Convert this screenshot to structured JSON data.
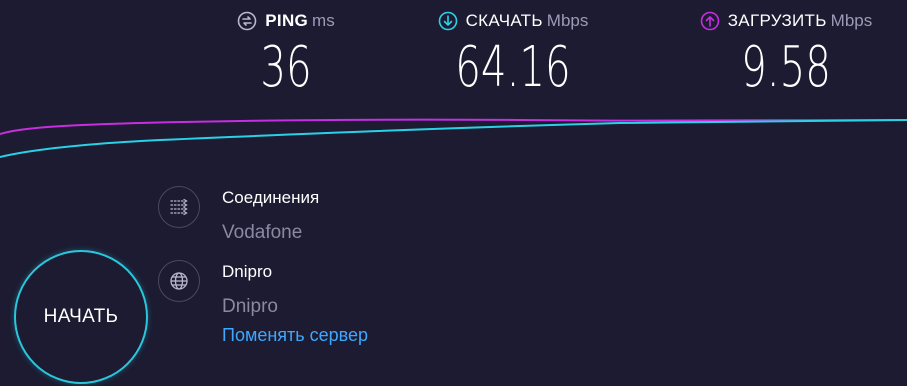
{
  "metrics": {
    "ping": {
      "label": "PING",
      "unit": "ms",
      "value": "36",
      "icon": "ping-icon",
      "color": "#b9b7cc"
    },
    "download": {
      "label": "СКАЧАТЬ",
      "unit": "Mbps",
      "value": "64.16",
      "icon": "download-icon",
      "color": "#2ad1e6"
    },
    "upload": {
      "label": "ЗАГРУЗИТЬ",
      "unit": "Mbps",
      "value": "9.58",
      "icon": "upload-icon",
      "color": "#c62ee0"
    }
  },
  "graph": {
    "download_color": "#2ad1e6",
    "upload_color": "#c62ee0"
  },
  "connection": {
    "title": "Соединения",
    "provider": "Vodafone",
    "icon": "connections-icon"
  },
  "server": {
    "title": "Dnipro",
    "location": "Dnipro",
    "change_label": "Поменять сервер",
    "icon": "globe-icon"
  },
  "start": {
    "label": "НАЧАТЬ",
    "color": "#2ac7dc"
  },
  "colors": {
    "background": "#1c1b31",
    "link": "#3ea8ff"
  }
}
